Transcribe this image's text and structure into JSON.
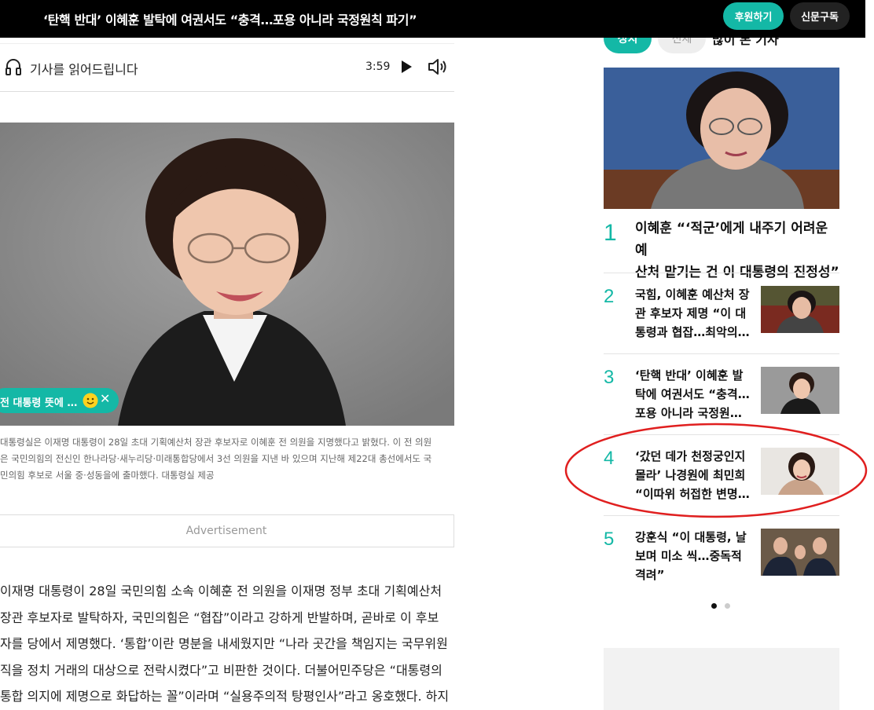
{
  "topbar": {
    "headline": "‘탄핵 반대’ 이혜훈 발탁에 여권서도 “충격…포용 아니라 국정원칙 파기”",
    "support_label": "후원하기",
    "subscribe_label": "신문구독",
    "colors": {
      "bg": "#000000",
      "accent": "#14b8a6"
    }
  },
  "audio": {
    "label": "기사를 읽어드립니다",
    "duration": "3:59",
    "icons": [
      "headphones-icon",
      "play-icon",
      "volume-icon"
    ]
  },
  "photo": {
    "chip_text": "전 대통령 뜻에 …",
    "chip_icons": [
      "smile-emoji-icon",
      "close-icon"
    ]
  },
  "caption": [
    "대통령실은 이재명 대통령이 28일 초대 기획예산처 장관 후보자로 이혜훈 전 의원을 지명했다고 밝혔다. 이 전 의원",
    "은 국민의힘의 전신인 한나라당·새누리당·미래통합당에서 3선 의원을 지낸 바 있으며 지난해 제22대 총선에서도 국",
    "민의힘 후보로 서울 중·성동을에 출마했다. 대통령실 제공"
  ],
  "ad_label": "Advertisement",
  "article_body": [
    "이재명 대통령이 28일 국민의힘 소속 이혜훈 전 의원을 이재명 정부 초대 기획예산처",
    "장관 후보자로 발탁하자, 국민의힘은 “협잡”이라고 강하게 반발하며, 곧바로 이 후보",
    "자를 당에서 제명했다. ‘통합’이란 명분을 내세웠지만 “나라 곳간을 책임지는 국무위원",
    "직을 정치 거래의 대상으로 전락시켰다”고 비판한 것이다. 더불어민주당은 “대통령의",
    "통합 의지에 제명으로 화답하는 꼴”이라며 “실용주의적 탕평인사”라고 옹호했다. 하지"
  ],
  "sidebar": {
    "tab_active": "정치",
    "tab_inactive": "전체",
    "title": "많이 본 기사",
    "items": [
      {
        "rank": "1",
        "lines": [
          "이혜훈 “‘적군’에게 내주기 어려운 예",
          "산처 맡기는 건 이 대통령의 진정성”"
        ]
      },
      {
        "rank": "2",
        "lines": [
          "국힘, 이혜훈 예산처 장",
          "관 후보자 제명 “이 대",
          "통령과 협잡…최악의…"
        ]
      },
      {
        "rank": "3",
        "lines": [
          "‘탄핵 반대’ 이혜훈 발",
          "탁에 여권서도 “충격…",
          "포용 아니라 국정원…"
        ]
      },
      {
        "rank": "4",
        "lines": [
          "‘갔던 데가 천정궁인지",
          "몰라’ 나경원에 최민희",
          "“이따위 허접한 변명…"
        ]
      },
      {
        "rank": "5",
        "lines": [
          "강훈식 “이 대통령, 날",
          "보며 미소 씩…중독적",
          "격려”"
        ]
      }
    ],
    "pagination": {
      "active": 1,
      "total": 2
    }
  }
}
